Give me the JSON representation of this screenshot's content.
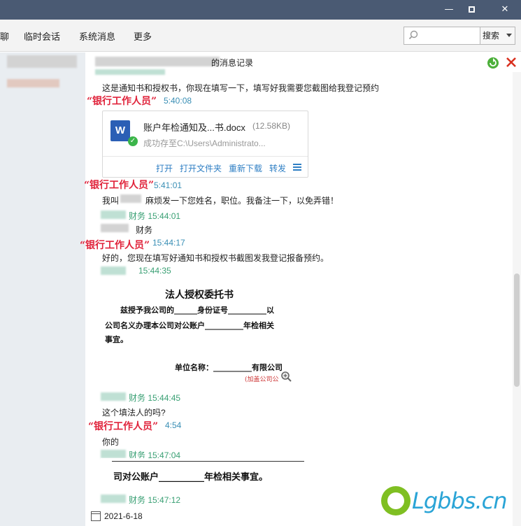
{
  "window": {
    "min_glyph": "—",
    "close_glyph": "✕"
  },
  "tabs": {
    "chat": "聊",
    "temp_session": "临时会话",
    "system_msg": "系统消息",
    "more": "更多"
  },
  "search": {
    "button_label": "搜索",
    "placeholder": ""
  },
  "header": {
    "title_suffix": "的消息记录"
  },
  "messages": {
    "m1_text": "这是通知书和授权书，你现在填写一下，填写好我需要您截图给我登记预约",
    "label_bank": "“银行工作人员”",
    "t1": "5:40:08",
    "file": {
      "name": "账户年检通知及...书.docx",
      "size": "(12.58KB)",
      "path": "成功存至C:\\Users\\Administrato...",
      "action_open": "打开",
      "action_open_folder": "打开文件夹",
      "action_redownload": "重新下载",
      "action_forward": "转发"
    },
    "t2": "5:41:01",
    "m2_prefix": "我叫",
    "m2_text": "麻烦发一下您姓名，职位。我备注一下，以免弄错！",
    "t3": "财务 15:44:01",
    "m3_text": "财务",
    "t4": "15:44:17",
    "m4_text": "好的，您现在填写好通知书和授权书截图发我登记报备预约。",
    "t5": "15:44:35",
    "doc": {
      "title": "法人授权委托书",
      "line1": "兹授予我公司的______身份证号__________以",
      "line2": "公司名义办理本公司对公账户__________年检相关",
      "line3": "事宜。",
      "line4": "单位名称：__________有限公司",
      "stamp": "(加盖公司公"
    },
    "t6": "财务 15:44:45",
    "m6_text": "这个填法人的吗?",
    "t7": "4:54",
    "m7_text": "你的",
    "t8": "财务 15:47:04",
    "doc2_text": "司对公账户__________年检相关事宜。",
    "t9": "财务 15:47:12",
    "date": "2021-6-18"
  },
  "watermark": {
    "text": "Lgbbs.cn"
  },
  "colors": {
    "title_bar": "#4a5a73",
    "bank_label": "#e0223a",
    "timestamp": "#3a8fb5",
    "link": "#2f7fc4"
  }
}
